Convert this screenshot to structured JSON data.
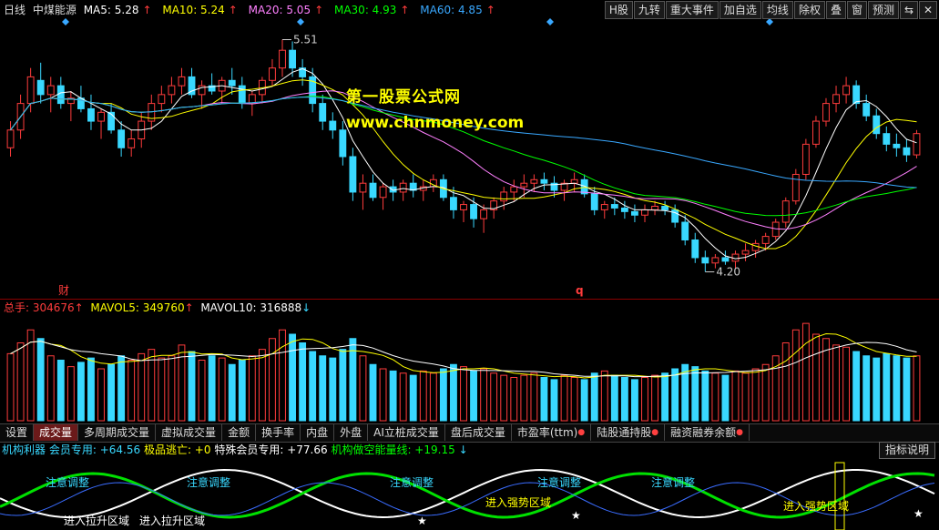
{
  "colors": {
    "up": "#ff3c3c",
    "down": "#39d8ff",
    "ma5": "#ffffff",
    "ma10": "#ffff00",
    "ma20": "#ff80ff",
    "ma30": "#00ff00",
    "ma60": "#39a8ff",
    "watermark": "#ffff00"
  },
  "header": {
    "period": "日线",
    "stock_name": "中煤能源",
    "ma5": "MA5: 5.28",
    "ma10": "MA10: 5.24",
    "ma20": "MA20: 5.05",
    "ma30": "MA30: 4.93",
    "ma60": "MA60: 4.85",
    "arrow": "↑"
  },
  "toolbar": [
    "H股",
    "九转",
    "重大事件",
    "加自选",
    "均线",
    "除权",
    "叠",
    "窗",
    "预测"
  ],
  "toolbar_icons": [
    "minimize-icon",
    "close-icon"
  ],
  "toolbar_icon_glyphs": [
    "⇆",
    "✕"
  ],
  "watermark": {
    "line1": "第一股票公式网",
    "line2": "www.chnmoney.com"
  },
  "price_annotations": {
    "high_label": "5.51",
    "low_label": "4.20",
    "marker_cai": "财",
    "marker_q": "q"
  },
  "volume_legend": {
    "total": "总手: 304676",
    "mavol5": "MAVOL5: 349760",
    "mavol10": "MAVOL10: 316888",
    "up": "↑",
    "down": "↓"
  },
  "tabs": [
    {
      "label": "设置",
      "active": false,
      "dot": false
    },
    {
      "label": "成交量",
      "active": true,
      "dot": false
    },
    {
      "label": "多周期成交量",
      "active": false,
      "dot": false
    },
    {
      "label": "虚拟成交量",
      "active": false,
      "dot": false
    },
    {
      "label": "金额",
      "active": false,
      "dot": false
    },
    {
      "label": "换手率",
      "active": false,
      "dot": false
    },
    {
      "label": "内盘",
      "active": false,
      "dot": false
    },
    {
      "label": "外盘",
      "active": false,
      "dot": false
    },
    {
      "label": "AI立桩成交量",
      "active": false,
      "dot": false
    },
    {
      "label": "盘后成交量",
      "active": false,
      "dot": false
    },
    {
      "label": "市盈率(ttm)",
      "active": false,
      "dot": true
    },
    {
      "label": "陆股通持股",
      "active": false,
      "dot": true
    },
    {
      "label": "融资融券余额",
      "active": false,
      "dot": true
    }
  ],
  "indicator_legend": {
    "name": "机构利器",
    "member": "会员专用: +64.56",
    "escape": "极品逃亡: +0",
    "special": "特殊会员专用: +77.66",
    "energy": "机构做空能量线: +19.15",
    "up": "↑",
    "down": "↓",
    "help": "指标说明"
  },
  "indicator_labels": {
    "caution": "注意调整",
    "pull_zone": "进入拉升区域",
    "strong_zone": "进入强势区域"
  },
  "chart_data": {
    "type": "candlestick",
    "price_range": [
      4.1,
      5.6
    ],
    "candles_ohlc": [
      [
        4.9,
        5.05,
        4.85,
        5.0
      ],
      [
        5.0,
        5.2,
        4.95,
        5.15
      ],
      [
        5.15,
        5.35,
        5.1,
        5.3
      ],
      [
        5.28,
        5.38,
        5.15,
        5.2
      ],
      [
        5.2,
        5.3,
        5.1,
        5.25
      ],
      [
        5.25,
        5.3,
        5.12,
        5.15
      ],
      [
        5.15,
        5.22,
        5.05,
        5.18
      ],
      [
        5.18,
        5.25,
        5.1,
        5.12
      ],
      [
        5.12,
        5.2,
        5.0,
        5.05
      ],
      [
        5.05,
        5.12,
        4.95,
        5.1
      ],
      [
        5.1,
        5.15,
        4.98,
        5.0
      ],
      [
        5.0,
        5.05,
        4.85,
        4.9
      ],
      [
        4.9,
        5.0,
        4.85,
        4.95
      ],
      [
        4.95,
        5.1,
        4.9,
        5.05
      ],
      [
        5.05,
        5.2,
        5.0,
        5.15
      ],
      [
        5.15,
        5.25,
        5.1,
        5.2
      ],
      [
        5.2,
        5.3,
        5.15,
        5.25
      ],
      [
        5.25,
        5.35,
        5.2,
        5.3
      ],
      [
        5.3,
        5.35,
        5.18,
        5.2
      ],
      [
        5.2,
        5.28,
        5.12,
        5.25
      ],
      [
        5.25,
        5.32,
        5.2,
        5.22
      ],
      [
        5.22,
        5.3,
        5.15,
        5.28
      ],
      [
        5.28,
        5.35,
        5.2,
        5.25
      ],
      [
        5.25,
        5.3,
        5.12,
        5.15
      ],
      [
        5.15,
        5.22,
        5.08,
        5.2
      ],
      [
        5.2,
        5.3,
        5.15,
        5.28
      ],
      [
        5.28,
        5.4,
        5.25,
        5.35
      ],
      [
        5.35,
        5.51,
        5.3,
        5.45
      ],
      [
        5.45,
        5.5,
        5.3,
        5.35
      ],
      [
        5.35,
        5.4,
        5.25,
        5.3
      ],
      [
        5.3,
        5.35,
        5.1,
        5.15
      ],
      [
        5.15,
        5.2,
        5.0,
        5.05
      ],
      [
        5.05,
        5.1,
        4.95,
        5.0
      ],
      [
        5.0,
        5.05,
        4.8,
        4.85
      ],
      [
        4.85,
        4.9,
        4.6,
        4.65
      ],
      [
        4.65,
        4.75,
        4.55,
        4.7
      ],
      [
        4.7,
        4.75,
        4.6,
        4.62
      ],
      [
        4.62,
        4.7,
        4.55,
        4.68
      ],
      [
        4.68,
        4.72,
        4.6,
        4.65
      ],
      [
        4.65,
        4.72,
        4.6,
        4.7
      ],
      [
        4.7,
        4.75,
        4.62,
        4.66
      ],
      [
        4.66,
        4.72,
        4.6,
        4.68
      ],
      [
        4.68,
        4.75,
        4.65,
        4.72
      ],
      [
        4.72,
        4.75,
        4.6,
        4.62
      ],
      [
        4.62,
        4.68,
        4.5,
        4.55
      ],
      [
        4.55,
        4.6,
        4.48,
        4.58
      ],
      [
        4.58,
        4.62,
        4.45,
        4.5
      ],
      [
        4.5,
        4.58,
        4.42,
        4.55
      ],
      [
        4.55,
        4.62,
        4.5,
        4.6
      ],
      [
        4.6,
        4.68,
        4.55,
        4.65
      ],
      [
        4.65,
        4.72,
        4.6,
        4.68
      ],
      [
        4.68,
        4.75,
        4.62,
        4.7
      ],
      [
        4.7,
        4.75,
        4.65,
        4.72
      ],
      [
        4.72,
        4.76,
        4.66,
        4.7
      ],
      [
        4.7,
        4.74,
        4.62,
        4.66
      ],
      [
        4.66,
        4.72,
        4.6,
        4.7
      ],
      [
        4.7,
        4.76,
        4.65,
        4.72
      ],
      [
        4.72,
        4.75,
        4.62,
        4.64
      ],
      [
        4.64,
        4.68,
        4.52,
        4.55
      ],
      [
        4.55,
        4.6,
        4.5,
        4.58
      ],
      [
        4.58,
        4.62,
        4.52,
        4.56
      ],
      [
        4.56,
        4.6,
        4.5,
        4.54
      ],
      [
        4.54,
        4.58,
        4.48,
        4.52
      ],
      [
        4.52,
        4.58,
        4.48,
        4.55
      ],
      [
        4.55,
        4.6,
        4.52,
        4.57
      ],
      [
        4.57,
        4.6,
        4.52,
        4.55
      ],
      [
        4.55,
        4.58,
        4.45,
        4.48
      ],
      [
        4.48,
        4.52,
        4.35,
        4.38
      ],
      [
        4.38,
        4.42,
        4.25,
        4.28
      ],
      [
        4.28,
        4.32,
        4.2,
        4.25
      ],
      [
        4.25,
        4.3,
        4.22,
        4.28
      ],
      [
        4.28,
        4.32,
        4.24,
        4.26
      ],
      [
        4.26,
        4.32,
        4.22,
        4.3
      ],
      [
        4.3,
        4.36,
        4.26,
        4.32
      ],
      [
        4.32,
        4.38,
        4.28,
        4.36
      ],
      [
        4.36,
        4.42,
        4.32,
        4.4
      ],
      [
        4.4,
        4.5,
        4.38,
        4.48
      ],
      [
        4.48,
        4.62,
        4.45,
        4.6
      ],
      [
        4.6,
        4.78,
        4.58,
        4.75
      ],
      [
        4.75,
        4.95,
        4.72,
        4.92
      ],
      [
        4.92,
        5.08,
        4.9,
        5.05
      ],
      [
        5.05,
        5.18,
        5.02,
        5.15
      ],
      [
        5.15,
        5.25,
        5.1,
        5.2
      ],
      [
        5.2,
        5.3,
        5.15,
        5.25
      ],
      [
        5.25,
        5.28,
        5.12,
        5.15
      ],
      [
        5.15,
        5.2,
        5.05,
        5.08
      ],
      [
        5.08,
        5.12,
        4.95,
        4.98
      ],
      [
        4.98,
        5.02,
        4.88,
        4.92
      ],
      [
        4.92,
        4.98,
        4.85,
        4.9
      ],
      [
        4.9,
        4.95,
        4.82,
        4.86
      ],
      [
        4.86,
        5.0,
        4.84,
        4.98
      ]
    ],
    "volumes": [
      310,
      360,
      420,
      380,
      300,
      280,
      250,
      270,
      290,
      240,
      260,
      300,
      280,
      310,
      330,
      290,
      300,
      350,
      320,
      280,
      300,
      290,
      260,
      280,
      300,
      330,
      380,
      420,
      400,
      360,
      320,
      300,
      290,
      330,
      380,
      300,
      260,
      240,
      230,
      220,
      210,
      230,
      220,
      240,
      260,
      250,
      230,
      240,
      220,
      210,
      200,
      210,
      220,
      200,
      190,
      210,
      200,
      190,
      220,
      230,
      210,
      200,
      190,
      200,
      210,
      220,
      240,
      260,
      250,
      230,
      220,
      210,
      230,
      220,
      240,
      260,
      300,
      360,
      420,
      450,
      400,
      380,
      350,
      340,
      320,
      300,
      290,
      310,
      300,
      290,
      300
    ],
    "volume_range": [
      0,
      480
    ]
  }
}
